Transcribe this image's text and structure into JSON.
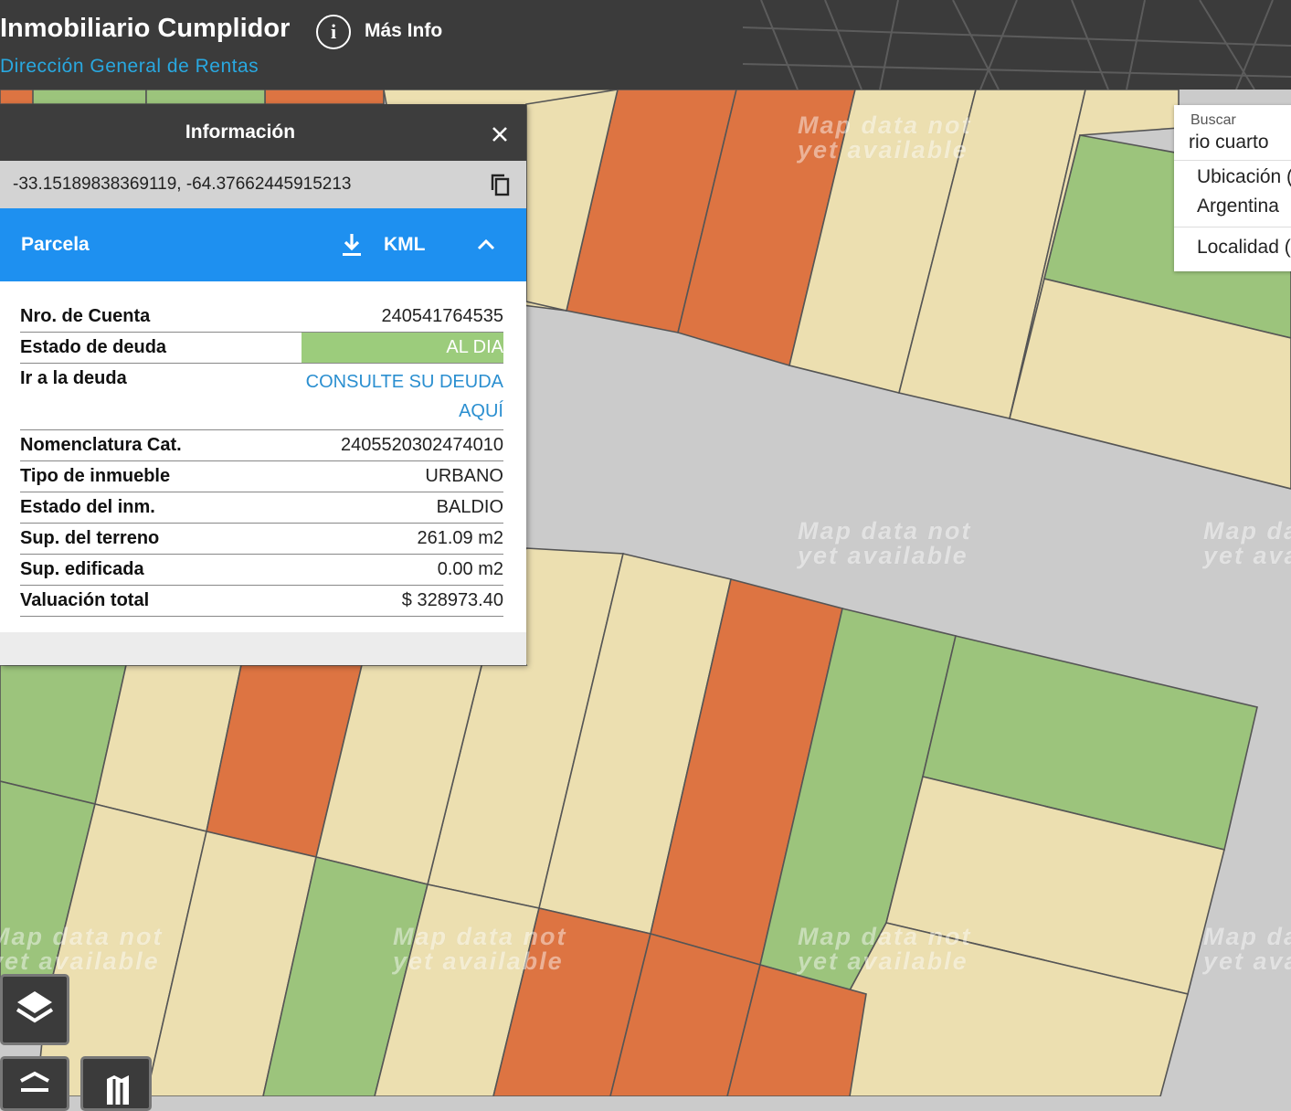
{
  "header": {
    "title": "Inmobiliario Cumplidor",
    "subtitle": "Dirección General de Rentas",
    "info_label": "Más Info",
    "info_icon": "info-circle-icon"
  },
  "panel": {
    "title": "Información",
    "coordinates": "-33.15189838369119, -64.37662445915213",
    "section": "Parcela",
    "kml_label": "KML",
    "rows": [
      {
        "label": "Nro. de Cuenta",
        "value": "240541764535"
      },
      {
        "label": "Estado de deuda",
        "value": "AL DIA"
      },
      {
        "label": "Ir a la deuda",
        "value": "CONSULTE SU DEUDA AQUÍ"
      },
      {
        "label": "Nomenclatura Cat.",
        "value": "2405520302474010"
      },
      {
        "label": "Tipo de inmueble",
        "value": "URBANO"
      },
      {
        "label": "Estado del inm.",
        "value": "BALDIO"
      },
      {
        "label": "Sup. del terreno",
        "value": "261.09 m2"
      },
      {
        "label": "Sup. edificada",
        "value": "0.00 m2"
      },
      {
        "label": "Valuación total",
        "value": "$ 328973.40"
      }
    ]
  },
  "search": {
    "label": "Buscar",
    "value": "rio cuarto",
    "suggestions": [
      "Ubicación (",
      "Argentina",
      "Localidad ("
    ]
  },
  "map": {
    "watermark_line1": "Map data not",
    "watermark_line2": "yet available",
    "colors": {
      "parcel_light": "#ecdfb0",
      "parcel_green": "#9cc47c",
      "parcel_orange": "#dd7442",
      "street": "#cbcbcb",
      "outline": "#555555",
      "pin": "#1d6fb0"
    }
  }
}
